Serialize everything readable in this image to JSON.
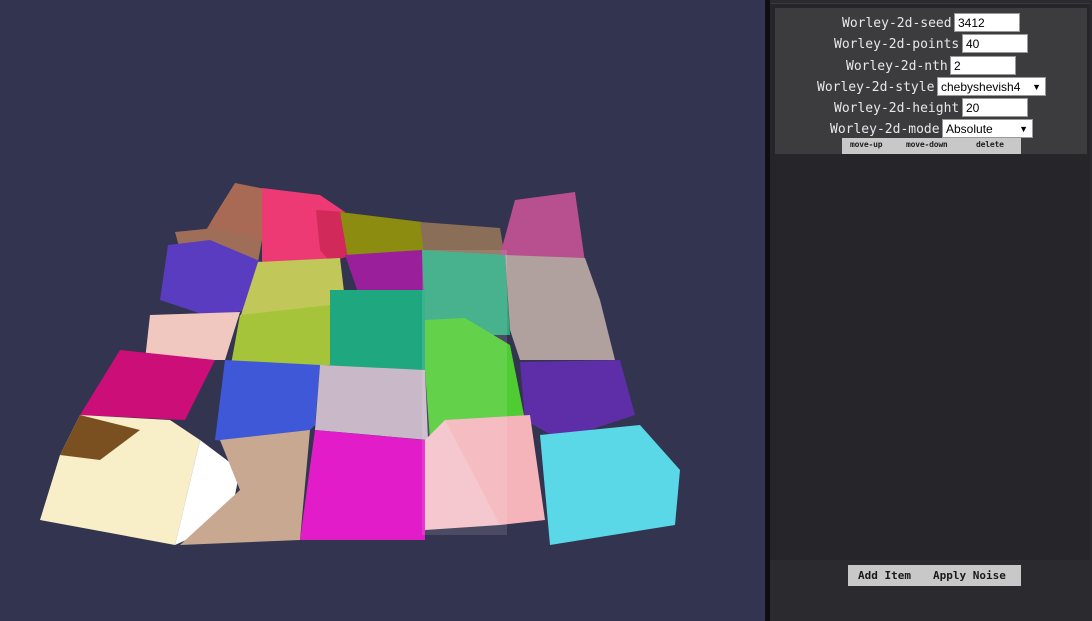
{
  "viewport": {
    "background": "#33344f",
    "description_icon": "terrain-mesh"
  },
  "panel": {
    "fields": [
      {
        "label": "Worley-2d-seed",
        "value": "3412"
      },
      {
        "label": "Worley-2d-points",
        "value": "40"
      },
      {
        "label": "Worley-2d-nth",
        "value": "2"
      },
      {
        "label": "Worley-2d-style",
        "value": "chebyshevish4"
      },
      {
        "label": "Worley-2d-height",
        "value": "20"
      },
      {
        "label": "Worley-2d-mode",
        "value": "Absolute"
      }
    ],
    "item_buttons": {
      "move_up": "move-up",
      "move_down": "move-down",
      "delete": "delete"
    },
    "bottom_buttons": {
      "add_item": "Add Item",
      "apply_noise": "Apply Noise"
    }
  }
}
